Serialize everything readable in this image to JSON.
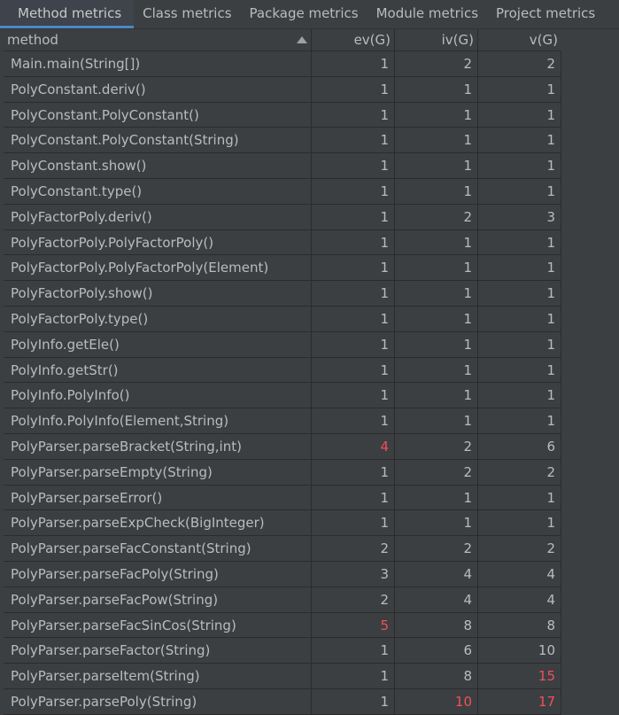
{
  "tabs": [
    {
      "label": "Method metrics",
      "active": true
    },
    {
      "label": "Class metrics",
      "active": false
    },
    {
      "label": "Package metrics",
      "active": false
    },
    {
      "label": "Module metrics",
      "active": false
    },
    {
      "label": "Project metrics",
      "active": false
    }
  ],
  "table": {
    "columns": [
      "method",
      "ev(G)",
      "iv(G)",
      "v(G)"
    ],
    "sort_column": "method",
    "sort_direction": "ascending",
    "warning_color": "#f0505a",
    "rows": [
      {
        "method": "Main.main(String[])",
        "ev": "1",
        "iv": "2",
        "v": "2"
      },
      {
        "method": "PolyConstant.deriv()",
        "ev": "1",
        "iv": "1",
        "v": "1"
      },
      {
        "method": "PolyConstant.PolyConstant()",
        "ev": "1",
        "iv": "1",
        "v": "1"
      },
      {
        "method": "PolyConstant.PolyConstant(String)",
        "ev": "1",
        "iv": "1",
        "v": "1"
      },
      {
        "method": "PolyConstant.show()",
        "ev": "1",
        "iv": "1",
        "v": "1"
      },
      {
        "method": "PolyConstant.type()",
        "ev": "1",
        "iv": "1",
        "v": "1"
      },
      {
        "method": "PolyFactorPoly.deriv()",
        "ev": "1",
        "iv": "2",
        "v": "3"
      },
      {
        "method": "PolyFactorPoly.PolyFactorPoly()",
        "ev": "1",
        "iv": "1",
        "v": "1"
      },
      {
        "method": "PolyFactorPoly.PolyFactorPoly(Element)",
        "ev": "1",
        "iv": "1",
        "v": "1"
      },
      {
        "method": "PolyFactorPoly.show()",
        "ev": "1",
        "iv": "1",
        "v": "1"
      },
      {
        "method": "PolyFactorPoly.type()",
        "ev": "1",
        "iv": "1",
        "v": "1"
      },
      {
        "method": "PolyInfo.getEle()",
        "ev": "1",
        "iv": "1",
        "v": "1"
      },
      {
        "method": "PolyInfo.getStr()",
        "ev": "1",
        "iv": "1",
        "v": "1"
      },
      {
        "method": "PolyInfo.PolyInfo()",
        "ev": "1",
        "iv": "1",
        "v": "1"
      },
      {
        "method": "PolyInfo.PolyInfo(Element,String)",
        "ev": "1",
        "iv": "1",
        "v": "1"
      },
      {
        "method": "PolyParser.parseBracket(String,int)",
        "ev": "4",
        "iv": "2",
        "v": "6",
        "ev_warn": true
      },
      {
        "method": "PolyParser.parseEmpty(String)",
        "ev": "1",
        "iv": "2",
        "v": "2"
      },
      {
        "method": "PolyParser.parseError()",
        "ev": "1",
        "iv": "1",
        "v": "1"
      },
      {
        "method": "PolyParser.parseExpCheck(BigInteger)",
        "ev": "1",
        "iv": "1",
        "v": "1"
      },
      {
        "method": "PolyParser.parseFacConstant(String)",
        "ev": "2",
        "iv": "2",
        "v": "2"
      },
      {
        "method": "PolyParser.parseFacPoly(String)",
        "ev": "3",
        "iv": "4",
        "v": "4"
      },
      {
        "method": "PolyParser.parseFacPow(String)",
        "ev": "2",
        "iv": "4",
        "v": "4"
      },
      {
        "method": "PolyParser.parseFacSinCos(String)",
        "ev": "5",
        "iv": "8",
        "v": "8",
        "ev_warn": true
      },
      {
        "method": "PolyParser.parseFactor(String)",
        "ev": "1",
        "iv": "6",
        "v": "10"
      },
      {
        "method": "PolyParser.parseItem(String)",
        "ev": "1",
        "iv": "8",
        "v": "15",
        "v_warn": true
      },
      {
        "method": "PolyParser.parsePoly(String)",
        "ev": "1",
        "iv": "10",
        "v": "17",
        "iv_warn": true,
        "v_warn": true
      }
    ]
  }
}
